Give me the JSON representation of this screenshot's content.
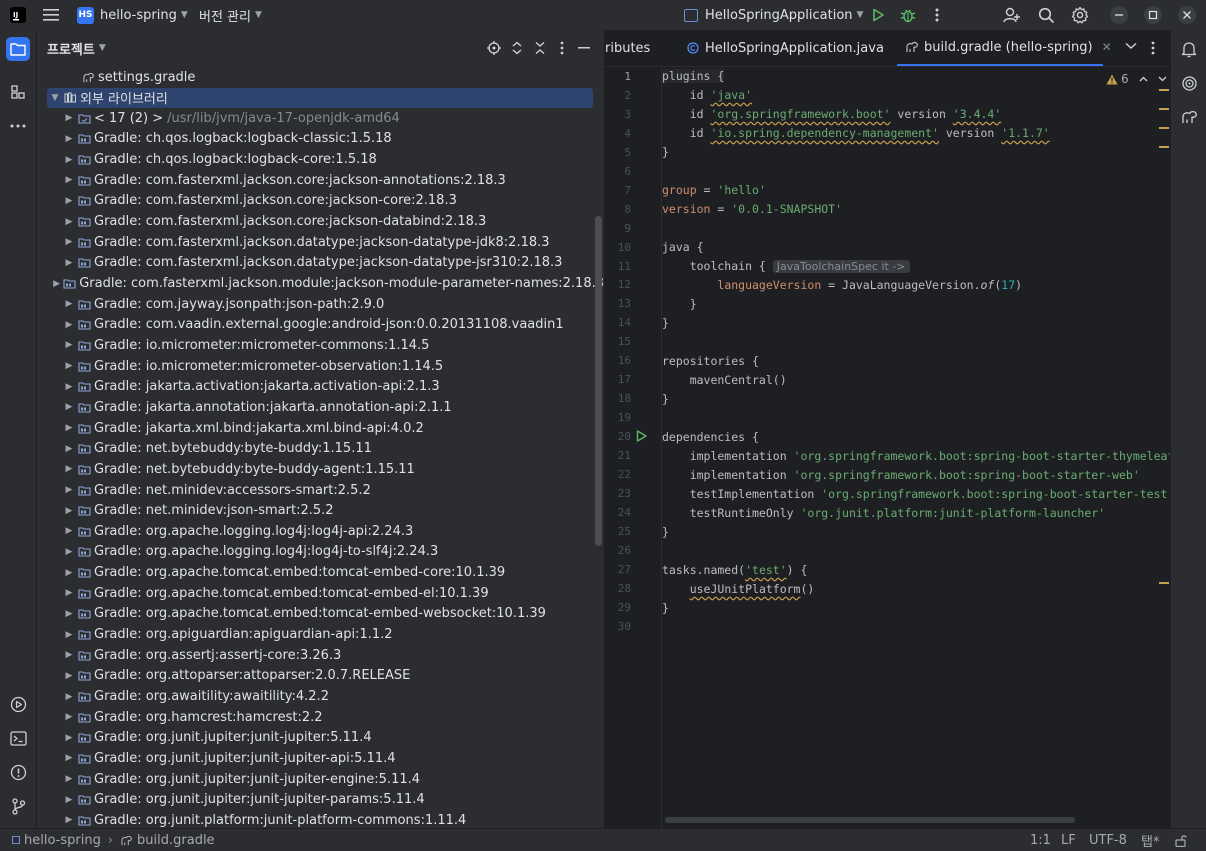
{
  "titlebar": {
    "project_badge": "HS",
    "project_name": "hello-spring",
    "vcs_menu": "버전 관리",
    "run_config": "HelloSpringApplication"
  },
  "project_panel": {
    "title": "프로젝트",
    "tree": [
      {
        "label": "settings.gradle",
        "kind": "file"
      },
      {
        "label": "외부 라이브러리",
        "kind": "root",
        "selected": true
      },
      {
        "label": "< 17 (2) >",
        "extra": "/usr/lib/jvm/java-17-openjdk-amd64",
        "kind": "jdk"
      },
      {
        "label": "Gradle: ch.qos.logback:logback-classic:1.5.18"
      },
      {
        "label": "Gradle: ch.qos.logback:logback-core:1.5.18"
      },
      {
        "label": "Gradle: com.fasterxml.jackson.core:jackson-annotations:2.18.3"
      },
      {
        "label": "Gradle: com.fasterxml.jackson.core:jackson-core:2.18.3"
      },
      {
        "label": "Gradle: com.fasterxml.jackson.core:jackson-databind:2.18.3"
      },
      {
        "label": "Gradle: com.fasterxml.jackson.datatype:jackson-datatype-jdk8:2.18.3"
      },
      {
        "label": "Gradle: com.fasterxml.jackson.datatype:jackson-datatype-jsr310:2.18.3"
      },
      {
        "label": "Gradle: com.fasterxml.jackson.module:jackson-module-parameter-names:2.18.3"
      },
      {
        "label": "Gradle: com.jayway.jsonpath:json-path:2.9.0"
      },
      {
        "label": "Gradle: com.vaadin.external.google:android-json:0.0.20131108.vaadin1"
      },
      {
        "label": "Gradle: io.micrometer:micrometer-commons:1.14.5"
      },
      {
        "label": "Gradle: io.micrometer:micrometer-observation:1.14.5"
      },
      {
        "label": "Gradle: jakarta.activation:jakarta.activation-api:2.1.3"
      },
      {
        "label": "Gradle: jakarta.annotation:jakarta.annotation-api:2.1.1"
      },
      {
        "label": "Gradle: jakarta.xml.bind:jakarta.xml.bind-api:4.0.2"
      },
      {
        "label": "Gradle: net.bytebuddy:byte-buddy:1.15.11"
      },
      {
        "label": "Gradle: net.bytebuddy:byte-buddy-agent:1.15.11"
      },
      {
        "label": "Gradle: net.minidev:accessors-smart:2.5.2"
      },
      {
        "label": "Gradle: net.minidev:json-smart:2.5.2"
      },
      {
        "label": "Gradle: org.apache.logging.log4j:log4j-api:2.24.3"
      },
      {
        "label": "Gradle: org.apache.logging.log4j:log4j-to-slf4j:2.24.3"
      },
      {
        "label": "Gradle: org.apache.tomcat.embed:tomcat-embed-core:10.1.39"
      },
      {
        "label": "Gradle: org.apache.tomcat.embed:tomcat-embed-el:10.1.39"
      },
      {
        "label": "Gradle: org.apache.tomcat.embed:tomcat-embed-websocket:10.1.39"
      },
      {
        "label": "Gradle: org.apiguardian:apiguardian-api:1.1.2"
      },
      {
        "label": "Gradle: org.assertj:assertj-core:3.26.3"
      },
      {
        "label": "Gradle: org.attoparser:attoparser:2.0.7.RELEASE"
      },
      {
        "label": "Gradle: org.awaitility:awaitility:4.2.2"
      },
      {
        "label": "Gradle: org.hamcrest:hamcrest:2.2"
      },
      {
        "label": "Gradle: org.junit.jupiter:junit-jupiter:5.11.4"
      },
      {
        "label": "Gradle: org.junit.jupiter:junit-jupiter-api:5.11.4"
      },
      {
        "label": "Gradle: org.junit.jupiter:junit-jupiter-engine:5.11.4"
      },
      {
        "label": "Gradle: org.junit.jupiter:junit-jupiter-params:5.11.4"
      },
      {
        "label": "Gradle: org.junit.platform:junit-platform-commons:1.11.4"
      }
    ]
  },
  "editor": {
    "tabs": [
      {
        "label": "ributes",
        "active": false,
        "kind": "partial"
      },
      {
        "label": "HelloSpringApplication.java",
        "active": false,
        "kind": "java"
      },
      {
        "label": "build.gradle (hello-spring)",
        "active": true,
        "kind": "gradle"
      }
    ],
    "warning_count": "6",
    "inlay_hint": "JavaToolchainSpec it ->",
    "line_numbers": [
      "1",
      "2",
      "3",
      "4",
      "5",
      "6",
      "7",
      "8",
      "9",
      "10",
      "11",
      "12",
      "13",
      "14",
      "15",
      "16",
      "17",
      "18",
      "19",
      "20",
      "21",
      "22",
      "23",
      "24",
      "25",
      "26",
      "27",
      "28",
      "29",
      "30"
    ],
    "code_lines": [
      "plugins {",
      "    id 'java'",
      "    id 'org.springframework.boot' version '3.4.4'",
      "    id 'io.spring.dependency-management' version '1.1.7'",
      "}",
      "",
      "group = 'hello'",
      "version = '0.0.1-SNAPSHOT'",
      "",
      "java {",
      "    toolchain {",
      "        languageVersion = JavaLanguageVersion.of(17)",
      "    }",
      "}",
      "",
      "repositories {",
      "    mavenCentral()",
      "}",
      "",
      "dependencies {",
      "    implementation 'org.springframework.boot:spring-boot-starter-thymeleaf'",
      "    implementation 'org.springframework.boot:spring-boot-starter-web'",
      "    testImplementation 'org.springframework.boot:spring-boot-starter-test'",
      "    testRuntimeOnly 'org.junit.platform:junit-platform-launcher'",
      "}",
      "",
      "tasks.named('test') {",
      "    useJUnitPlatform()",
      "}",
      ""
    ]
  },
  "statusbar": {
    "breadcrumb_project": "hello-spring",
    "breadcrumb_file": "build.gradle",
    "position": "1:1",
    "line_ending": "LF",
    "encoding": "UTF-8",
    "indent": "탭*"
  },
  "colors": {
    "accent": "#3574f0",
    "selection": "#2e436e",
    "keyword": "#cf8e6d",
    "string": "#6aab73",
    "number": "#2aacb8",
    "warning": "#c8a14e",
    "run_green": "#5fb865"
  }
}
